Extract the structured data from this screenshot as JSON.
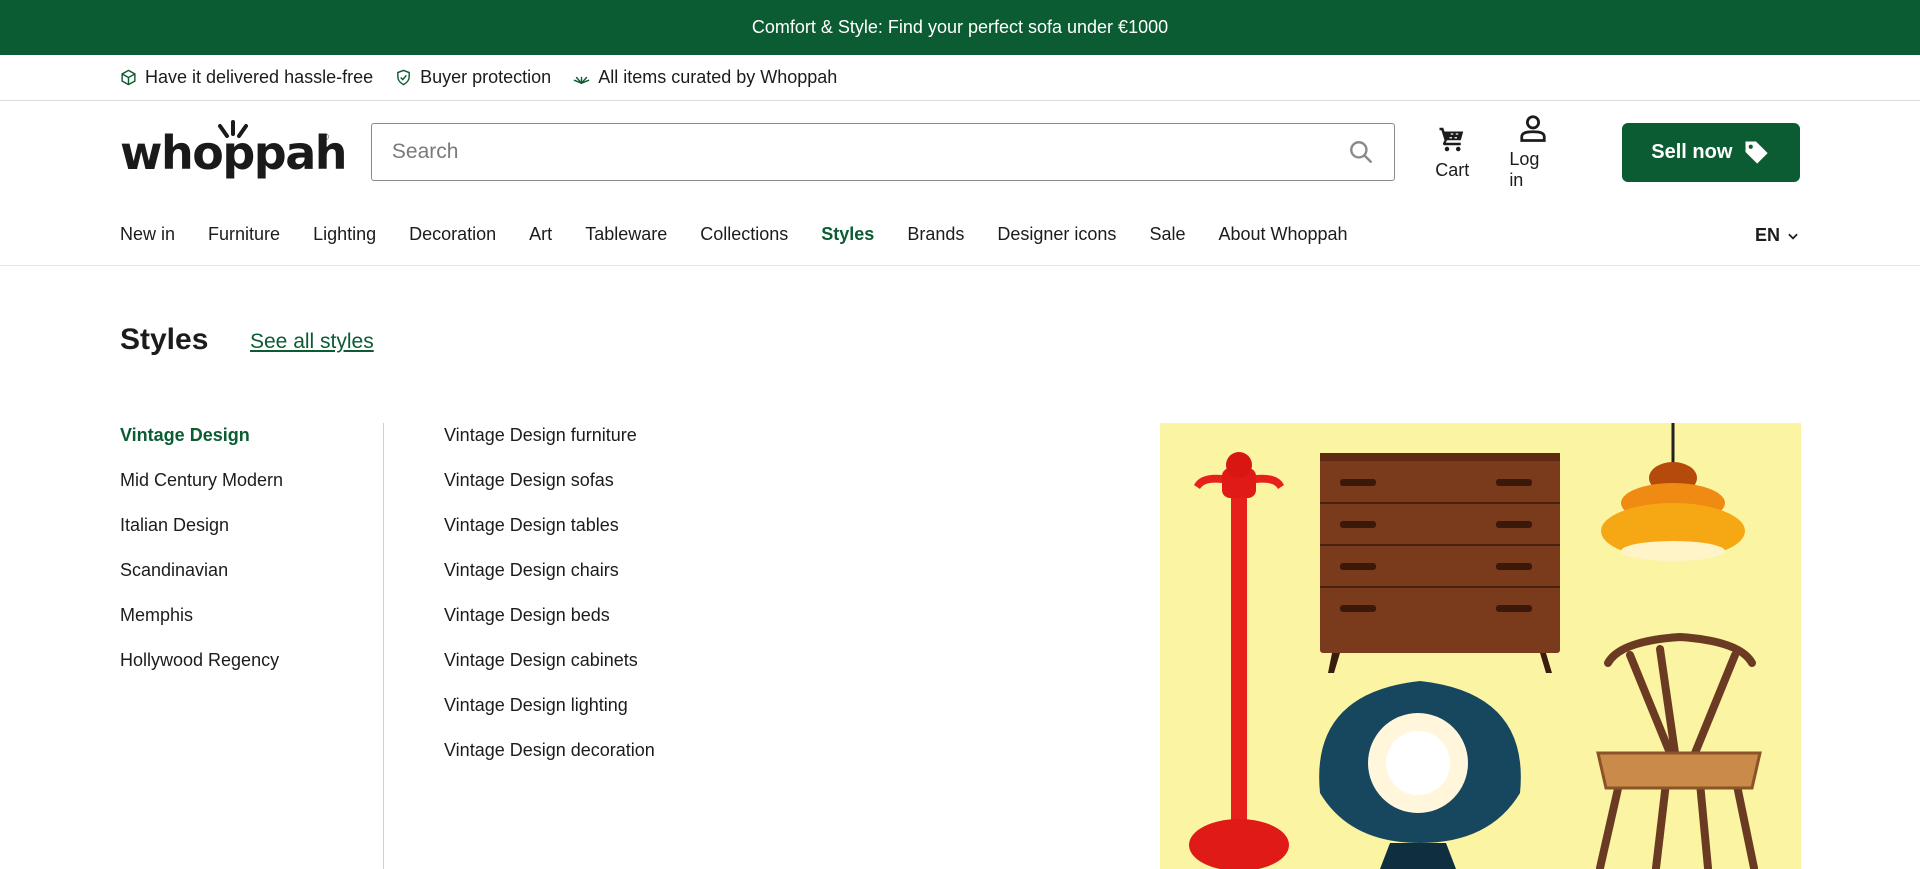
{
  "promo_banner": {
    "text": "Comfort & Style: Find your perfect sofa under €1000"
  },
  "usps": [
    {
      "icon": "box-icon",
      "label": "Have it delivered hassle-free"
    },
    {
      "icon": "shield-check-icon",
      "label": "Buyer protection"
    },
    {
      "icon": "sparkle-icon",
      "label": "All items curated by Whoppah"
    }
  ],
  "header": {
    "logo_text": "whoppah",
    "logo_reg": "®",
    "search_placeholder": "Search",
    "cart_label": "Cart",
    "login_label": "Log in",
    "sell_label": "Sell now"
  },
  "nav": {
    "items": [
      {
        "label": "New in"
      },
      {
        "label": "Furniture"
      },
      {
        "label": "Lighting"
      },
      {
        "label": "Decoration"
      },
      {
        "label": "Art"
      },
      {
        "label": "Tableware"
      },
      {
        "label": "Collections"
      },
      {
        "label": "Styles",
        "active": true
      },
      {
        "label": "Brands"
      },
      {
        "label": "Designer icons"
      },
      {
        "label": "Sale"
      },
      {
        "label": "About Whoppah"
      }
    ],
    "language": "EN"
  },
  "panel": {
    "title": "Styles",
    "see_all": "See all styles",
    "styles": [
      {
        "label": "Vintage Design",
        "active": true
      },
      {
        "label": "Mid Century Modern"
      },
      {
        "label": "Italian Design"
      },
      {
        "label": "Scandinavian"
      },
      {
        "label": "Memphis"
      },
      {
        "label": "Hollywood Regency"
      }
    ],
    "subcategories": [
      {
        "label": "Vintage Design furniture"
      },
      {
        "label": "Vintage Design sofas"
      },
      {
        "label": "Vintage Design tables"
      },
      {
        "label": "Vintage Design chairs"
      },
      {
        "label": "Vintage Design beds"
      },
      {
        "label": "Vintage Design cabinets"
      },
      {
        "label": "Vintage Design lighting"
      },
      {
        "label": "Vintage Design decoration"
      }
    ]
  },
  "colors": {
    "brand_green": "#0b5c33",
    "promo_image_bg": "#fbf4a3"
  }
}
